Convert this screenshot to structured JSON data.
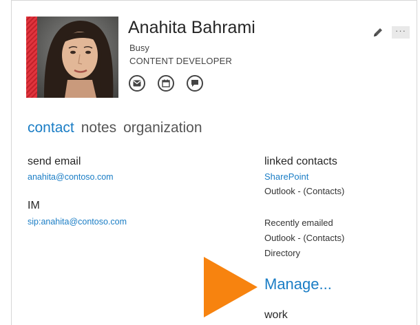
{
  "person": {
    "name": "Anahita Bahrami",
    "status": "Busy",
    "job_title": "CONTENT DEVELOPER"
  },
  "header": {
    "more_label": "···"
  },
  "tabs": [
    {
      "label": "contact",
      "active": true
    },
    {
      "label": "notes",
      "active": false
    },
    {
      "label": "organization",
      "active": false
    }
  ],
  "contact": {
    "email_heading": "send email",
    "email_value": "anahita@contoso.com",
    "im_heading": "IM",
    "im_value": "sip:anahita@contoso.com"
  },
  "linked": {
    "heading": "linked contacts",
    "sharepoint": "SharePoint",
    "outlook_contacts": "Outlook - (Contacts)",
    "recently_emailed": "Recently emailed",
    "recent_outlook": "Outlook - (Contacts)",
    "directory": "Directory",
    "manage_label": "Manage...",
    "work_heading": "work"
  },
  "colors": {
    "accent": "#1a7dc5",
    "busy": "#e0343d",
    "callout_arrow": "#f7830f"
  },
  "icons": [
    "email-icon",
    "calendar-icon",
    "chat-icon",
    "edit-pencil-icon",
    "more-icon"
  ]
}
